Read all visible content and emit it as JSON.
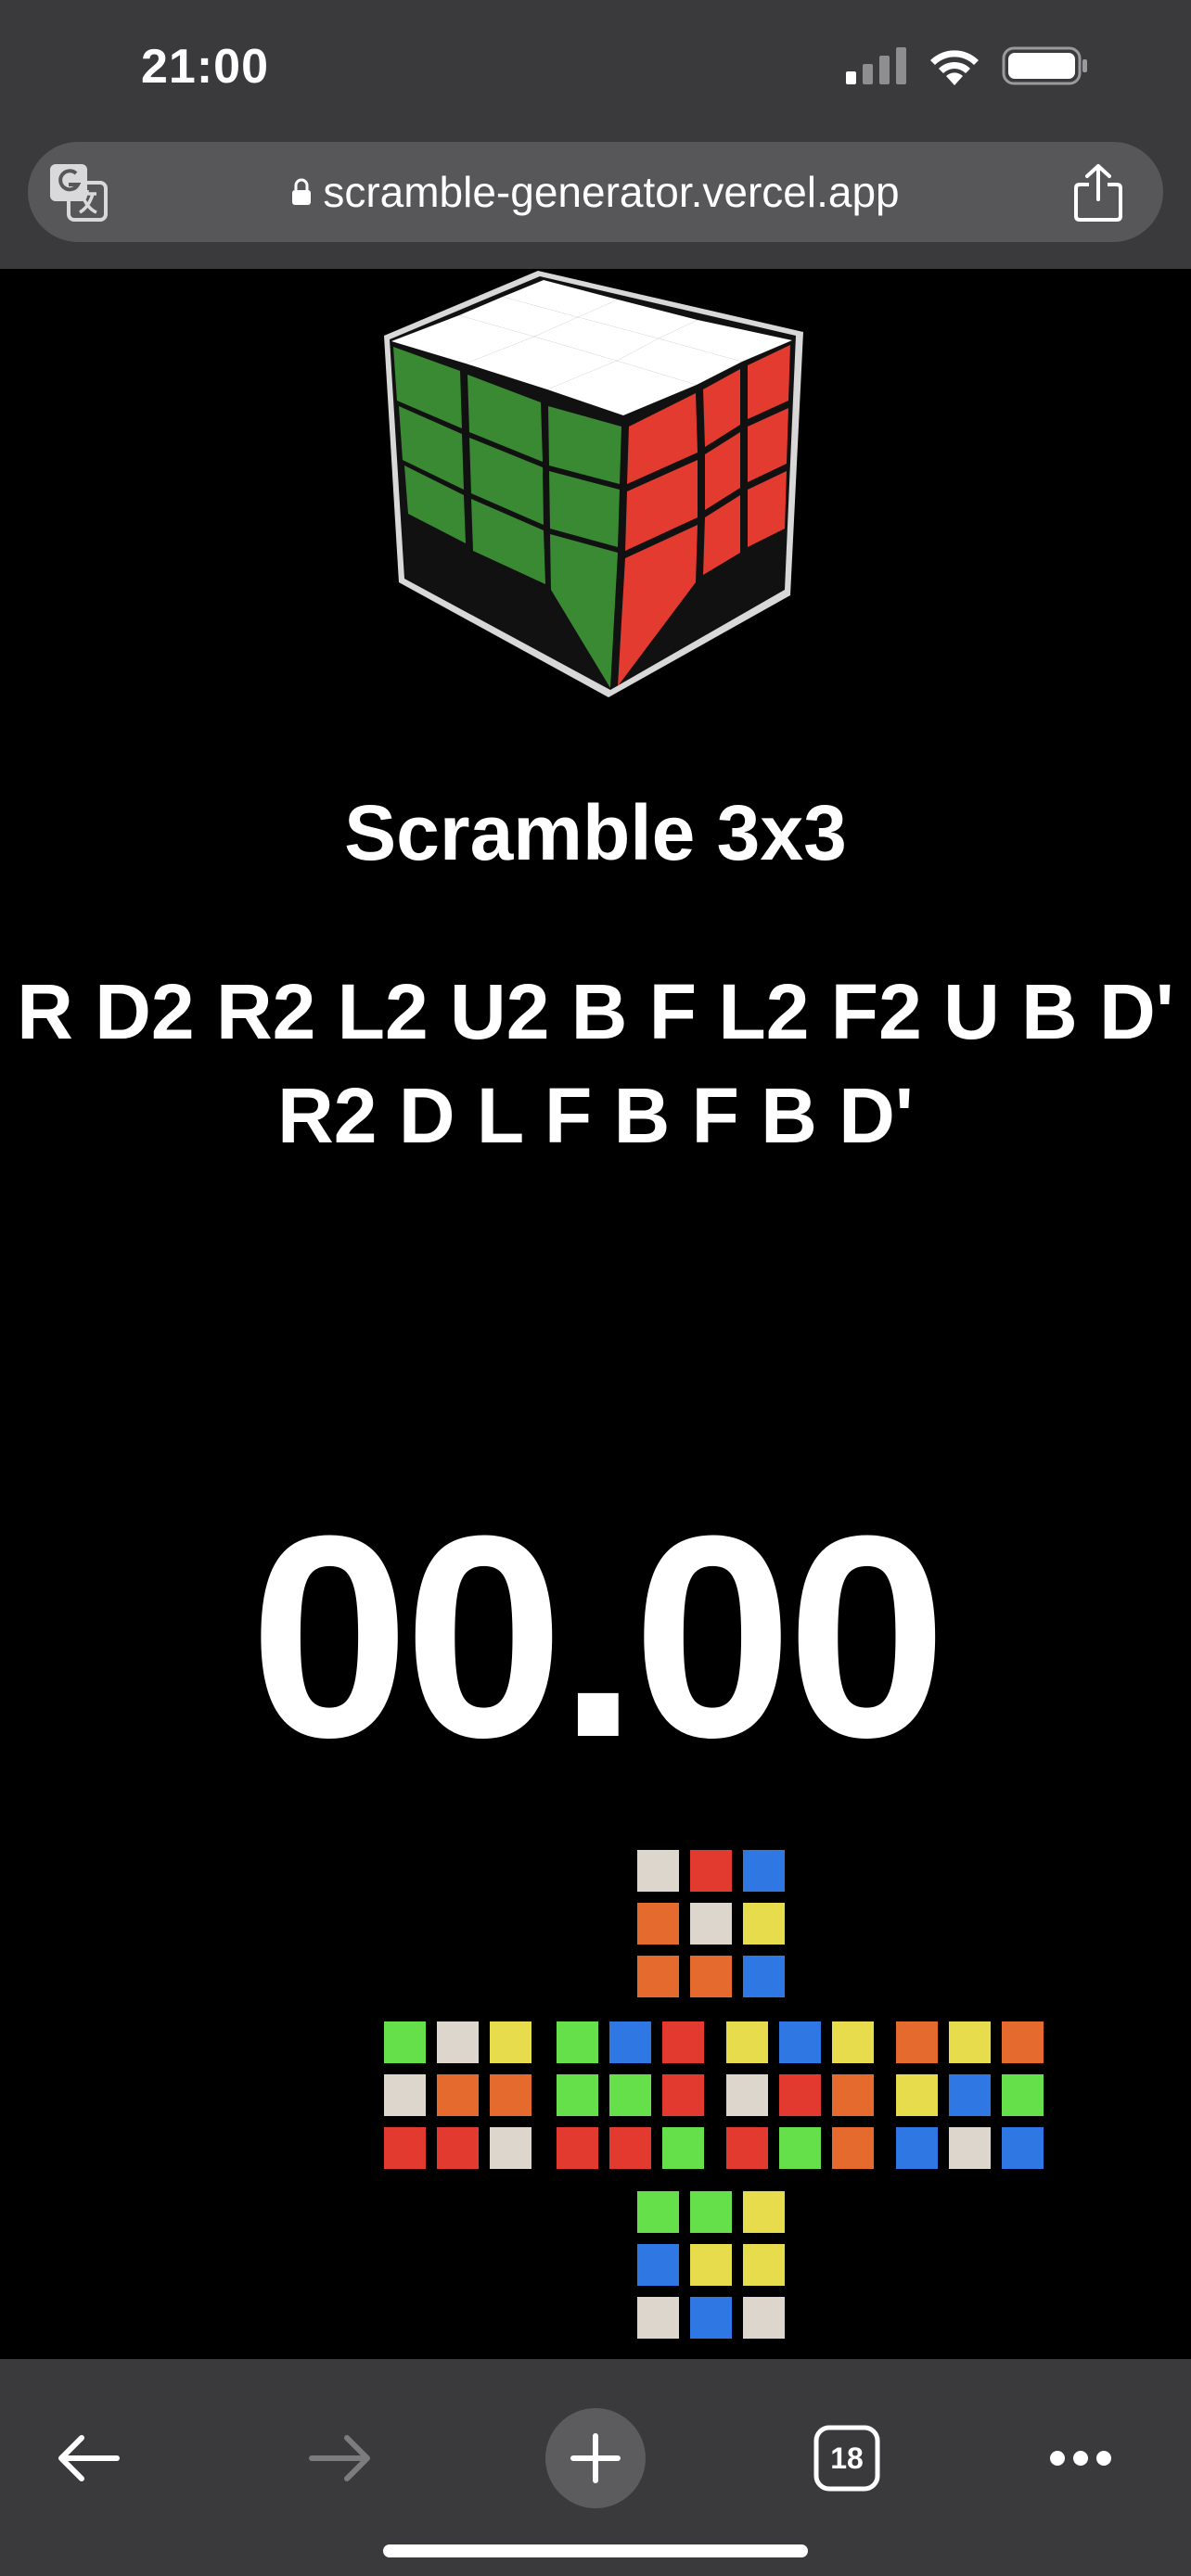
{
  "status_bar": {
    "time": "21:00",
    "icons": [
      "cellular-signal-icon",
      "wifi-icon",
      "battery-icon"
    ]
  },
  "browser": {
    "url": "scramble-generator.vercel.app",
    "icons": [
      "translate-icon",
      "lock-icon",
      "share-icon"
    ]
  },
  "page": {
    "title": "Scramble 3x3",
    "scramble": "R D2 R2 L2 U2 B F L2 F2 U B D' R2 D L F B F B D'",
    "timer": "00.00"
  },
  "colors": {
    "white": "#dcd6cc",
    "red": "#e23a2e",
    "blue": "#2f78e4",
    "orange": "#e46a2e",
    "yellow": "#e6dc4c",
    "green": "#66e04a",
    "logo_green": "#3a8a34",
    "logo_red": "#e33b2f"
  },
  "cube_net": {
    "U": [
      "W",
      "R",
      "B",
      "O",
      "W",
      "Y",
      "O",
      "O",
      "B"
    ],
    "L": [
      "G",
      "W",
      "Y",
      "W",
      "O",
      "O",
      "R",
      "R",
      "W"
    ],
    "F": [
      "G",
      "B",
      "R",
      "G",
      "G",
      "R",
      "R",
      "R",
      "G"
    ],
    "R": [
      "Y",
      "B",
      "Y",
      "W",
      "R",
      "O",
      "R",
      "G",
      "O"
    ],
    "B": [
      "O",
      "Y",
      "O",
      "Y",
      "B",
      "G",
      "B",
      "W",
      "B"
    ],
    "D": [
      "G",
      "G",
      "Y",
      "B",
      "Y",
      "Y",
      "W",
      "B",
      "W"
    ]
  },
  "toolbar": {
    "tab_count": "18",
    "icons": [
      "back-arrow-icon",
      "forward-arrow-icon",
      "plus-icon",
      "tabs-icon",
      "more-icon"
    ]
  }
}
